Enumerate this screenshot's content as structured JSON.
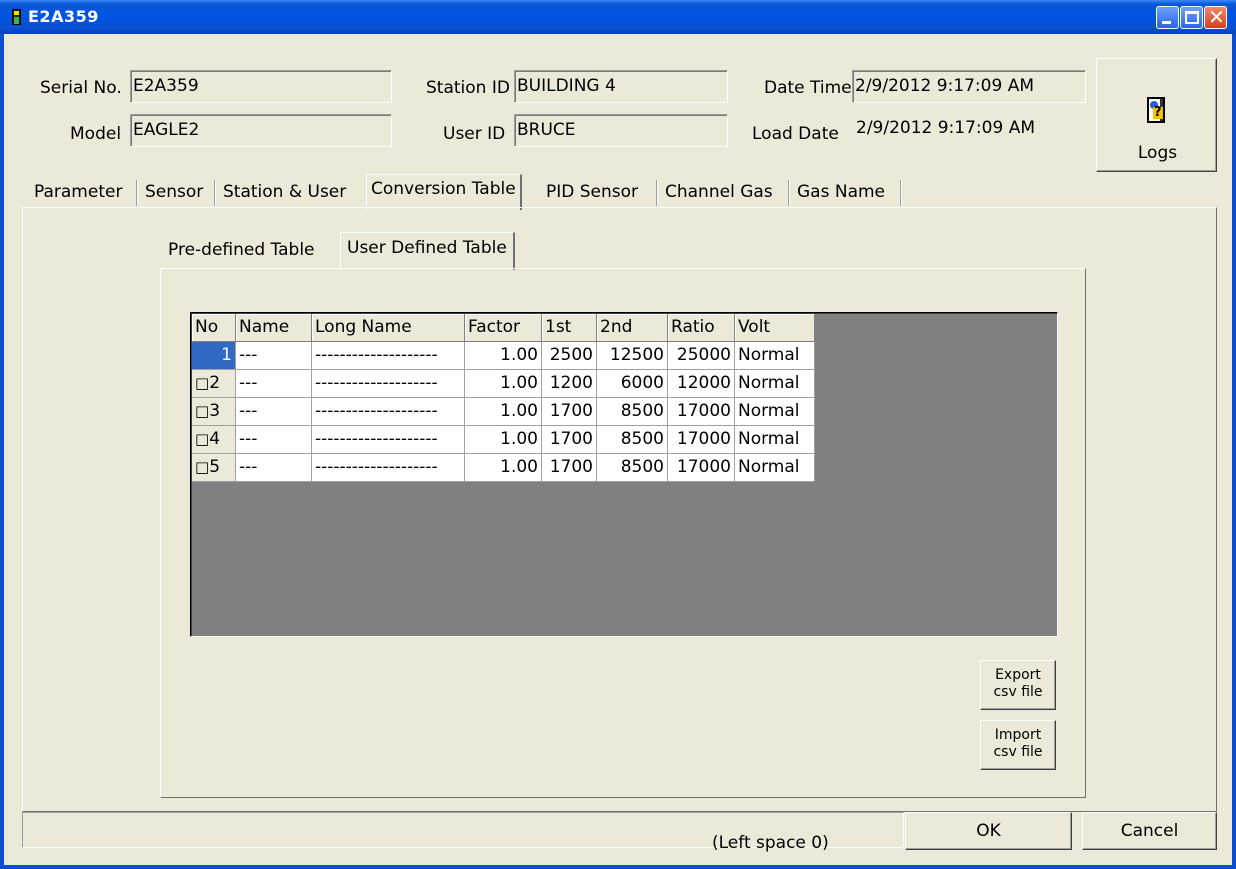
{
  "window": {
    "title": "E2A359",
    "close_glyph": "✕"
  },
  "info": {
    "serial_label": "Serial No.",
    "serial_value": "E2A359",
    "model_label": "Model",
    "model_value": "EAGLE2",
    "station_label": "Station ID",
    "station_value": "BUILDING 4",
    "user_label": "User ID",
    "user_value": "BRUCE",
    "datetime_label": "Date Time",
    "datetime_value": "2/9/2012 9:17:09 AM",
    "loaddate_label": "Load Date",
    "loaddate_value": "2/9/2012 9:17:09 AM",
    "logs_label": "Logs"
  },
  "tabs": [
    "Parameter",
    "Sensor",
    "Station & User",
    "Conversion Table",
    "PID Sensor",
    "Channel Gas",
    "Gas Name"
  ],
  "subtabs": [
    "Pre-defined Table",
    "User Defined Table"
  ],
  "table": {
    "columns": [
      "No",
      "Name",
      "Long Name",
      "Factor",
      "1st",
      "2nd",
      "Ratio",
      "Volt"
    ],
    "rows": [
      {
        "no": "1",
        "name": "---",
        "long_name": "--------------------",
        "factor": "1.00",
        "first": "2500",
        "second": "12500",
        "ratio": "25000",
        "volt": "Normal"
      },
      {
        "no": "2",
        "name": "---",
        "long_name": "--------------------",
        "factor": "1.00",
        "first": "1200",
        "second": "6000",
        "ratio": "12000",
        "volt": "Normal"
      },
      {
        "no": "3",
        "name": "---",
        "long_name": "--------------------",
        "factor": "1.00",
        "first": "1700",
        "second": "8500",
        "ratio": "17000",
        "volt": "Normal"
      },
      {
        "no": "4",
        "name": "---",
        "long_name": "--------------------",
        "factor": "1.00",
        "first": "1700",
        "second": "8500",
        "ratio": "17000",
        "volt": "Normal"
      },
      {
        "no": "5",
        "name": "---",
        "long_name": "--------------------",
        "factor": "1.00",
        "first": "1700",
        "second": "8500",
        "ratio": "17000",
        "volt": "Normal"
      }
    ]
  },
  "buttons": {
    "export_line1": "Export",
    "export_line2": "csv file",
    "import_line1": "Import",
    "import_line2": "csv file",
    "ok": "OK",
    "cancel": "Cancel"
  },
  "status": {
    "left_space": "(Left space 0)"
  },
  "colors": {
    "title_bar": "#0054e3",
    "selection": "#316ac5",
    "grid_background": "#808080"
  }
}
